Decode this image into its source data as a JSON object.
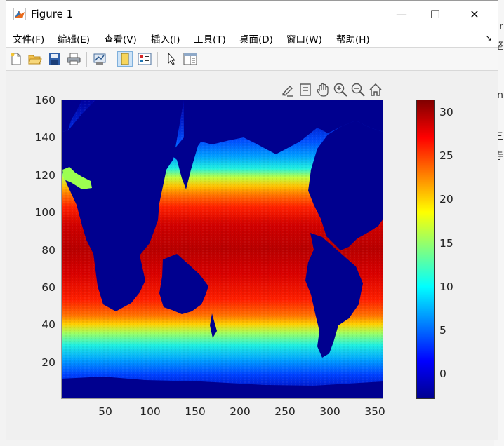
{
  "window": {
    "title": "Figure 1",
    "controls": {
      "minimize": "—",
      "maximize": "☐",
      "close": "✕"
    }
  },
  "menu": {
    "items": [
      "文件(F)",
      "编辑(E)",
      "查看(V)",
      "插入(I)",
      "工具(T)",
      "桌面(D)",
      "窗口(W)",
      "帮助(H)"
    ],
    "overflow": "↘"
  },
  "toolbar": {
    "icons": [
      "new-figure-icon",
      "open-file-icon",
      "save-icon",
      "print-icon",
      "link-plot-icon",
      "colorbar-icon",
      "legend-icon",
      "pointer-icon",
      "property-inspector-icon"
    ]
  },
  "axes_toolbar": {
    "icons": [
      "brush-icon",
      "datatip-icon",
      "pan-icon",
      "zoom-in-icon",
      "zoom-out-icon",
      "home-icon"
    ]
  },
  "colors": {
    "ocean_deep": "#00008f",
    "land_mask": "#00008f",
    "accent_warm": "#d00000"
  },
  "chart_data": {
    "type": "heatmap",
    "title": "",
    "xlabel": "",
    "ylabel": "",
    "xlim": [
      0,
      360
    ],
    "ylim": [
      0,
      160
    ],
    "x_ticks": [
      "50",
      "100",
      "150",
      "200",
      "250",
      "300",
      "350"
    ],
    "y_ticks": [
      "20",
      "40",
      "60",
      "80",
      "100",
      "120",
      "140",
      "160"
    ],
    "colormap": "jet",
    "clim": [
      -3,
      31
    ],
    "colorbar_ticks": [
      "0",
      "5",
      "10",
      "15",
      "20",
      "25",
      "30"
    ],
    "grid": false
  },
  "background_app": {
    "glyphs": [
      ".r",
      "整",
      "n",
      "三",
      "寺"
    ]
  }
}
